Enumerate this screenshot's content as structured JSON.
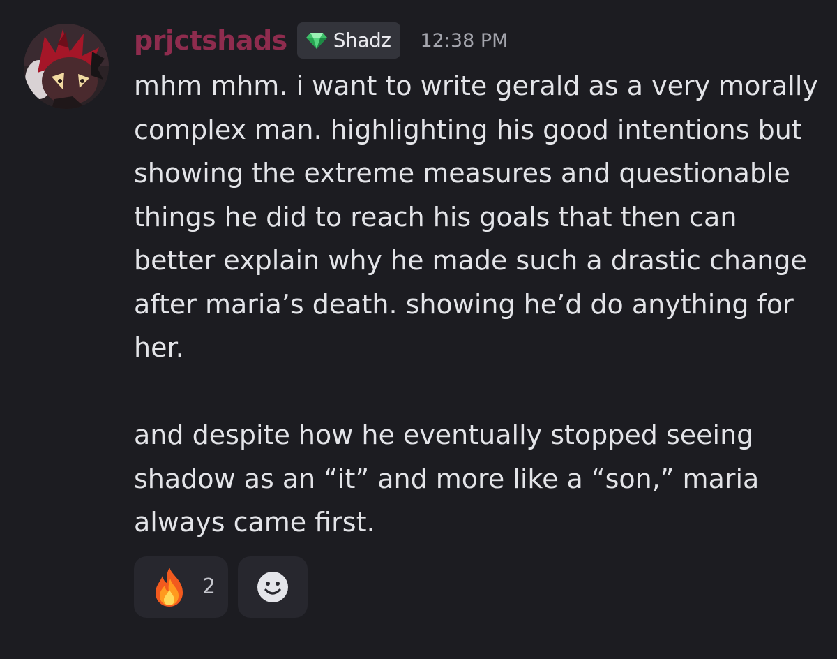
{
  "message": {
    "author": "prjctshads",
    "author_color": "#8e2c4e",
    "tag": {
      "icon": "green-gem-icon",
      "text": "Shadz"
    },
    "timestamp": "12:38 PM",
    "paragraphs": [
      "mhm mhm. i want to write gerald as a very morally complex man. highlighting his good intentions but showing the extreme measures and questionable things he did to reach his goals that then can better explain why he made such a drastic change after maria’s death. showing he’d do anything for her.",
      "and despite how he eventually stopped seeing shadow as an “it” and more like a “son,” maria always came first."
    ]
  },
  "reactions": [
    {
      "icon": "fire-emoji-icon",
      "count": "2"
    }
  ],
  "add_reaction_icon": "add-reaction-smiley-icon",
  "colors": {
    "background": "#1c1c21",
    "text": "#e3e4e8",
    "timestamp": "#a4a5ad",
    "tag_background": "#33343b",
    "reaction_background": "#27272e"
  }
}
